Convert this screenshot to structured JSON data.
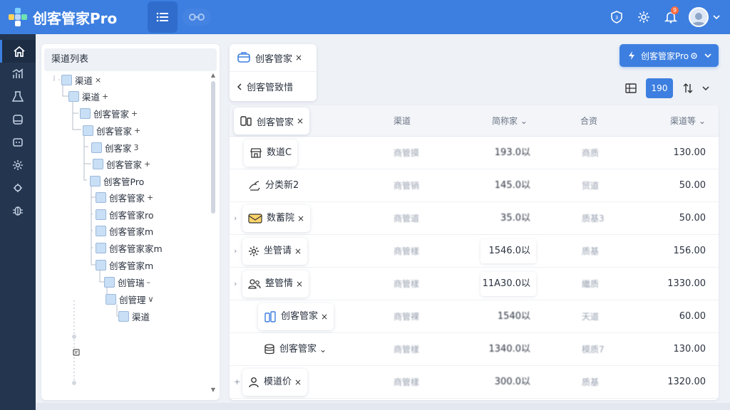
{
  "app": {
    "title": "创客管家Pro"
  },
  "colors": {
    "primary": "#3d7fe0",
    "nav_bg": "#24364f",
    "badge": "#ff6a3d"
  },
  "header": {
    "menu_icon": "list-icon",
    "right_icons": [
      "shield-icon",
      "settings-icon",
      "bell-icon"
    ],
    "notification_count": "9"
  },
  "leftnav": {
    "items": [
      "home-icon",
      "chart-icon",
      "flask-icon",
      "database-icon",
      "message-icon",
      "gear-icon",
      "cog-icon",
      "bug-icon"
    ]
  },
  "tree": {
    "title": "渠道列表",
    "nodes": [
      {
        "label": "渠道",
        "suffix": "×"
      },
      {
        "label": "渠道",
        "suffix": "+"
      },
      {
        "label": "创客管家",
        "suffix": "+"
      },
      {
        "label": "创客管家",
        "suffix": "+"
      },
      {
        "label": "创客家",
        "suffix": "3"
      },
      {
        "label": "创客管家",
        "suffix": "+"
      },
      {
        "label": "创客管Pro",
        "suffix": ""
      },
      {
        "label": "创客管家",
        "suffix": "+"
      },
      {
        "label": "创客管家ro",
        "suffix": ""
      },
      {
        "label": "创客管家m",
        "suffix": ""
      },
      {
        "label": "创客管家家m",
        "suffix": ""
      },
      {
        "label": "创客管家m",
        "suffix": ""
      },
      {
        "label": "创管瑞",
        "suffix": "–"
      },
      {
        "label": "创管理",
        "suffix": "∨"
      },
      {
        "label": "渠道",
        "suffix": ""
      }
    ]
  },
  "tabs": [
    {
      "label": "创客管家",
      "close": "×"
    },
    {
      "label": "创客管致惜",
      "close": ""
    }
  ],
  "actions": {
    "primary_label": "创客管家Pro",
    "count": "190"
  },
  "table": {
    "columns": [
      "渠道",
      "简称家",
      "合资",
      "渠道等"
    ],
    "header_name": {
      "label": "创客管家",
      "close": "×"
    },
    "rows": [
      {
        "name": "数道C",
        "icon": "store-icon",
        "expand": "",
        "card": true,
        "channel": "商管摸",
        "amount": "193.0以",
        "type": "商质",
        "value": "130.00"
      },
      {
        "name": "分类新2",
        "icon": "hand-icon",
        "expand": "",
        "card": false,
        "channel": "商管销",
        "amount": "145.0以",
        "type": "贸道",
        "value": "50.00"
      },
      {
        "name": "数蓄院",
        "icon": "mail-icon",
        "expand": "›",
        "card": true,
        "channel": "商管道",
        "amount": "35.0以",
        "type": "质基3",
        "value": "50.00"
      },
      {
        "name": "坐管请",
        "icon": "settings-icon",
        "expand": "›",
        "card": true,
        "channel": "商管樣",
        "amount": "1546.0以",
        "type": "质基",
        "value": "156.00"
      },
      {
        "name": "整管情",
        "icon": "users-icon",
        "expand": "›",
        "card": true,
        "channel": "商管樣",
        "amount": "11A30.0以",
        "type": "繼质",
        "value": "1330.00"
      },
      {
        "name": "创客管家",
        "icon": "device-icon",
        "expand": "",
        "card": true,
        "channel": "商管裸",
        "amount": "1540以",
        "type": "天道",
        "value": "60.00"
      },
      {
        "name": "创客管家",
        "icon": "database-icon",
        "expand": "",
        "card": false,
        "channel": "商管樣",
        "amount": "1340.0以",
        "type": "模质7",
        "value": "130.00"
      },
      {
        "name": "模道价",
        "icon": "user-icon",
        "expand": "+",
        "card": true,
        "channel": "商管樣",
        "amount": "300.0以",
        "type": "质基",
        "value": "1320.00"
      }
    ]
  }
}
